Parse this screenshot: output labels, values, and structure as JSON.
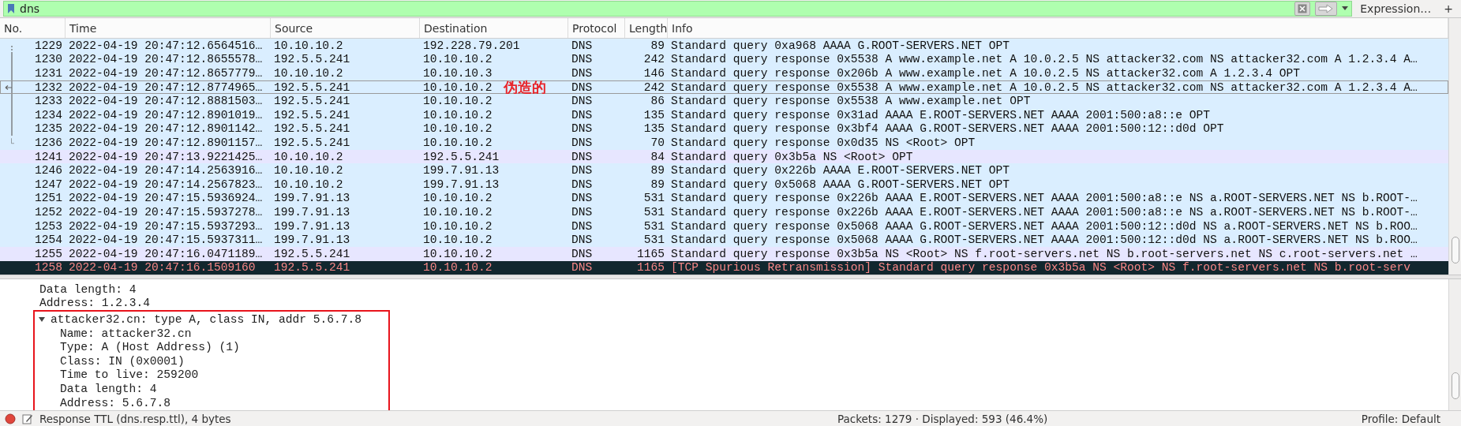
{
  "filter": {
    "value": "dns",
    "expression_label": "Expression…",
    "add_label": "+"
  },
  "columns": [
    "No.",
    "Time",
    "Source",
    "Destination",
    "Protocol",
    "Length",
    "Info"
  ],
  "rows": [
    {
      "no": "1229",
      "time": "2022-04-19 20:47:12.6564516…",
      "source": "10.10.10.2",
      "destination": "192.228.79.201",
      "protocol": "DNS",
      "length": "89",
      "info": "Standard query 0xa968 AAAA G.ROOT-SERVERS.NET OPT",
      "color": "#daeeff",
      "selected": false,
      "kind": "first"
    },
    {
      "no": "1230",
      "time": "2022-04-19 20:47:12.8655578…",
      "source": "192.5.5.241",
      "destination": "10.10.10.2",
      "protocol": "DNS",
      "length": "242",
      "info": "Standard query response 0x5538 A www.example.net A 10.0.2.5 NS attacker32.com NS attacker32.com A 1.2.3.4 A…",
      "color": "#daeeff",
      "selected": false,
      "kind": "middle"
    },
    {
      "no": "1231",
      "time": "2022-04-19 20:47:12.8657779…",
      "source": "10.10.10.2",
      "destination": "10.10.10.3",
      "protocol": "DNS",
      "length": "146",
      "info": "Standard query response 0x206b A www.example.net A 10.0.2.5 NS attacker32.com A 1.2.3.4 OPT",
      "color": "#daeeff",
      "selected": false,
      "kind": "middle"
    },
    {
      "no": "1232",
      "time": "2022-04-19 20:47:12.8774965…",
      "source": "192.5.5.241",
      "destination": "10.10.10.2",
      "protocol": "DNS",
      "length": "242",
      "info": "Standard query response 0x5538 A www.example.net A 10.0.2.5 NS attacker32.com NS attacker32.com A 1.2.3.4 A…",
      "color": "#daeeff",
      "selected": true,
      "kind": "current",
      "annotation": "伪造的"
    },
    {
      "no": "1233",
      "time": "2022-04-19 20:47:12.8881503…",
      "source": "192.5.5.241",
      "destination": "10.10.10.2",
      "protocol": "DNS",
      "length": "86",
      "info": "Standard query response 0x5538 A www.example.net OPT",
      "color": "#daeeff",
      "selected": false,
      "kind": "middle"
    },
    {
      "no": "1234",
      "time": "2022-04-19 20:47:12.8901019…",
      "source": "192.5.5.241",
      "destination": "10.10.10.2",
      "protocol": "DNS",
      "length": "135",
      "info": "Standard query response 0x31ad AAAA E.ROOT-SERVERS.NET AAAA 2001:500:a8::e OPT",
      "color": "#daeeff",
      "selected": false,
      "kind": "middle"
    },
    {
      "no": "1235",
      "time": "2022-04-19 20:47:12.8901142…",
      "source": "192.5.5.241",
      "destination": "10.10.10.2",
      "protocol": "DNS",
      "length": "135",
      "info": "Standard query response 0x3bf4 AAAA G.ROOT-SERVERS.NET AAAA 2001:500:12::d0d OPT",
      "color": "#daeeff",
      "selected": false,
      "kind": "middle"
    },
    {
      "no": "1236",
      "time": "2022-04-19 20:47:12.8901157…",
      "source": "192.5.5.241",
      "destination": "10.10.10.2",
      "protocol": "DNS",
      "length": "70",
      "info": "Standard query response 0x0d35 NS <Root> OPT",
      "color": "#daeeff",
      "selected": false,
      "kind": "last"
    },
    {
      "no": "1241",
      "time": "2022-04-19 20:47:13.9221425…",
      "source": "10.10.10.2",
      "destination": "192.5.5.241",
      "protocol": "DNS",
      "length": "84",
      "info": "Standard query 0x3b5a NS <Root> OPT",
      "color": "#e7e6ff",
      "selected": false
    },
    {
      "no": "1246",
      "time": "2022-04-19 20:47:14.2563916…",
      "source": "10.10.10.2",
      "destination": "199.7.91.13",
      "protocol": "DNS",
      "length": "89",
      "info": "Standard query 0x226b AAAA E.ROOT-SERVERS.NET OPT",
      "color": "#daeeff",
      "selected": false
    },
    {
      "no": "1247",
      "time": "2022-04-19 20:47:14.2567823…",
      "source": "10.10.10.2",
      "destination": "199.7.91.13",
      "protocol": "DNS",
      "length": "89",
      "info": "Standard query 0x5068 AAAA G.ROOT-SERVERS.NET OPT",
      "color": "#daeeff",
      "selected": false
    },
    {
      "no": "1251",
      "time": "2022-04-19 20:47:15.5936924…",
      "source": "199.7.91.13",
      "destination": "10.10.10.2",
      "protocol": "DNS",
      "length": "531",
      "info": "Standard query response 0x226b AAAA E.ROOT-SERVERS.NET AAAA 2001:500:a8::e NS a.ROOT-SERVERS.NET NS b.ROOT-…",
      "color": "#daeeff",
      "selected": false
    },
    {
      "no": "1252",
      "time": "2022-04-19 20:47:15.5937278…",
      "source": "199.7.91.13",
      "destination": "10.10.10.2",
      "protocol": "DNS",
      "length": "531",
      "info": "Standard query response 0x226b AAAA E.ROOT-SERVERS.NET AAAA 2001:500:a8::e NS a.ROOT-SERVERS.NET NS b.ROOT-…",
      "color": "#daeeff",
      "selected": false
    },
    {
      "no": "1253",
      "time": "2022-04-19 20:47:15.5937293…",
      "source": "199.7.91.13",
      "destination": "10.10.10.2",
      "protocol": "DNS",
      "length": "531",
      "info": "Standard query response 0x5068 AAAA G.ROOT-SERVERS.NET AAAA 2001:500:12::d0d NS a.ROOT-SERVERS.NET NS b.ROO…",
      "color": "#daeeff",
      "selected": false
    },
    {
      "no": "1254",
      "time": "2022-04-19 20:47:15.5937311…",
      "source": "199.7.91.13",
      "destination": "10.10.10.2",
      "protocol": "DNS",
      "length": "531",
      "info": "Standard query response 0x5068 AAAA G.ROOT-SERVERS.NET AAAA 2001:500:12::d0d NS a.ROOT-SERVERS.NET NS b.ROO…",
      "color": "#daeeff",
      "selected": false
    },
    {
      "no": "1255",
      "time": "2022-04-19 20:47:16.0471189…",
      "source": "192.5.5.241",
      "destination": "10.10.10.2",
      "protocol": "DNS",
      "length": "1165",
      "info": "Standard query response 0x3b5a NS <Root> NS f.root-servers.net NS b.root-servers.net NS c.root-servers.net …",
      "color": "#e7e6ff",
      "selected": false
    },
    {
      "no": "1258",
      "time": "2022-04-19 20:47:16.1509160",
      "source": "192.5.5.241",
      "destination": "10.10.10.2",
      "protocol": "DNS",
      "length": "1165",
      "info": "[TCP Spurious Retransmission] Standard query response 0x3b5a NS <Root> NS f.root-servers.net NS b.root-serv",
      "color": "#12272e",
      "selected": false
    }
  ],
  "details": [
    {
      "text": "Data length: 4"
    },
    {
      "text": "Address: 1.2.3.4"
    },
    {
      "text": "attacker32.cn: type A, class IN, addr 5.6.7.8",
      "expanded": true,
      "highlighted": true,
      "children": [
        {
          "text": "Name: attacker32.cn"
        },
        {
          "text": "Type: A (Host Address) (1)"
        },
        {
          "text": "Class: IN (0x0001)"
        },
        {
          "text": "Time to live: 259200"
        },
        {
          "text": "Data length: 4"
        },
        {
          "text": "Address: 5.6.7.8"
        }
      ]
    }
  ],
  "status_bar": {
    "field": "Response TTL (dns.resp.ttl), 4 bytes",
    "packets": "Packets: 1279 · Displayed: 593 (46.4%)",
    "profile": "Profile: Default"
  }
}
